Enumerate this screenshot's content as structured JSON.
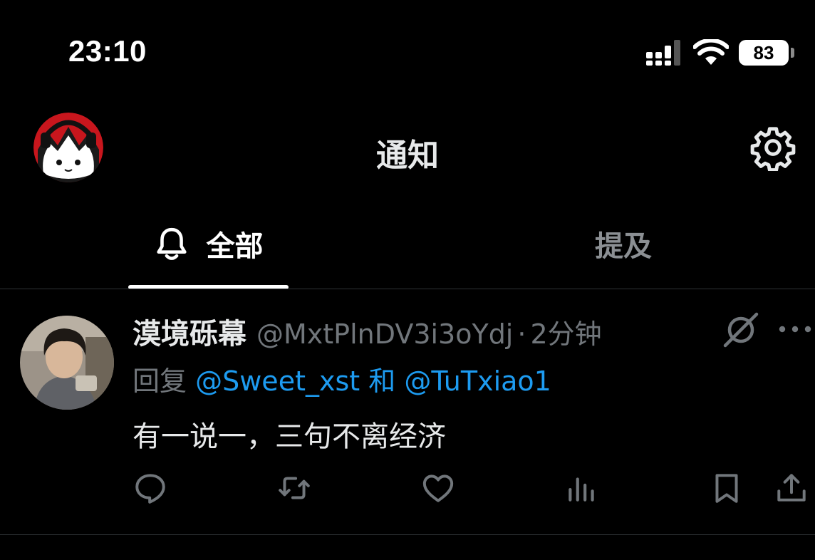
{
  "status_bar": {
    "time": "23:10",
    "battery": "83",
    "icons": [
      "cellular-signal-icon",
      "wifi-icon",
      "battery-icon"
    ]
  },
  "header": {
    "title": "通知",
    "icons": [
      "profile-avatar",
      "gear-icon"
    ]
  },
  "tabs": [
    {
      "label": "全部",
      "icon": "bell-icon",
      "selected": true
    },
    {
      "label": "提及",
      "selected": false
    }
  ],
  "notification": {
    "author_name": "漠境砾幕",
    "handle": "@MxtPlnDV3i3oYdj",
    "separator": "·",
    "time_ago": "2分钟",
    "reply_prefix": "回复",
    "mention_1": "@Sweet_xst",
    "conjunction": "和",
    "mention_2": "@TuTxiao1",
    "text": "有一说一，三句不离经济",
    "actions": [
      "reply-icon",
      "retweet-icon",
      "like-icon",
      "views-icon",
      "bookmark-icon",
      "share-icon"
    ]
  },
  "colors": {
    "background": "#000000",
    "text": "#e7e9ea",
    "muted": "#71767b",
    "accent": "#1d9bf0",
    "divider": "#2f3336"
  }
}
